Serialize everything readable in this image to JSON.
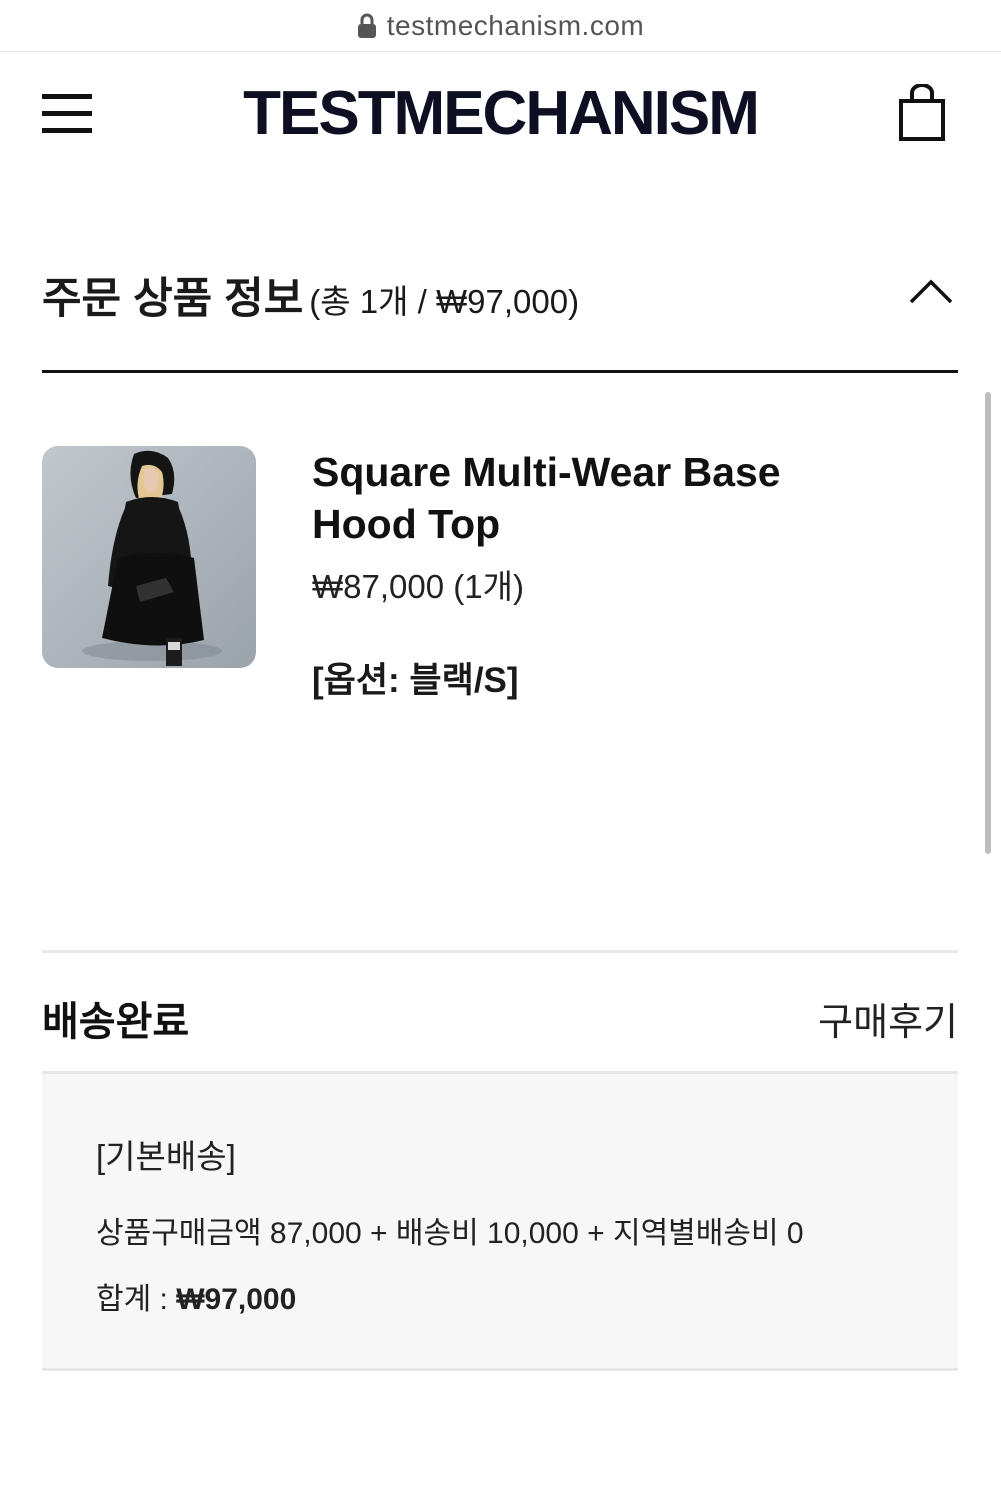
{
  "browser": {
    "url": "testmechanism.com",
    "icon": "lock-icon"
  },
  "header": {
    "brand": "TESTMECHANISM",
    "menu_icon": "hamburger-menu-icon",
    "cart_icon": "shopping-bag-icon"
  },
  "order_section": {
    "title": "주문 상품 정보",
    "summary": "(총 1개 / ₩97,000)",
    "toggle_icon": "chevron-up-icon"
  },
  "product": {
    "name": "Square Multi-Wear Base Hood Top",
    "price": "₩87,000 (1개)",
    "option": "[옵션: 블랙/S]"
  },
  "delivery": {
    "status": "배송완료",
    "review_label": "구매후기",
    "type": "[기본배송]",
    "calculation": "상품구매금액 87,000 + 배송비 10,000 + 지역별배송비 0",
    "total_label": "합계 : ",
    "total_value": "₩97,000"
  },
  "colors": {
    "text": "#1a1a1a",
    "brand": "#0f0f23",
    "panel": "#f7f7f8"
  }
}
